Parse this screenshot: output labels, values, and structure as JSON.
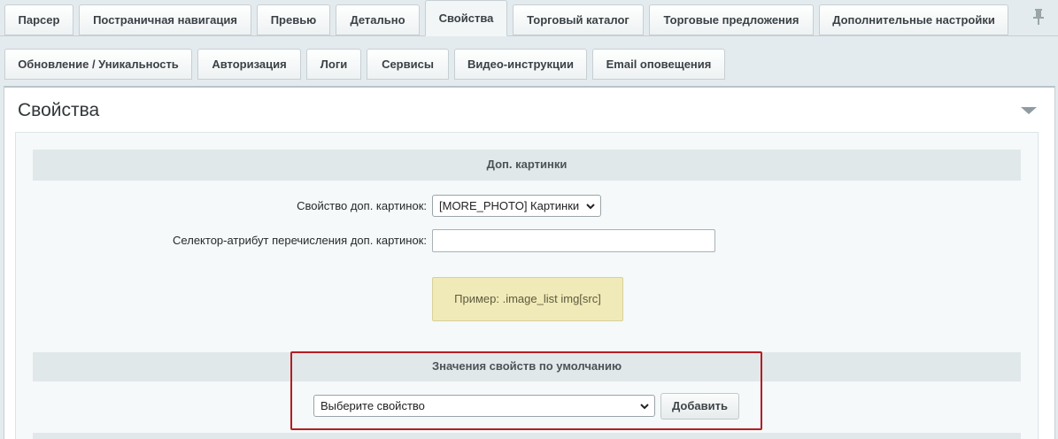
{
  "tabs_row1": [
    {
      "label": "Парсер",
      "active": false
    },
    {
      "label": "Постраничная навигация",
      "active": false
    },
    {
      "label": "Превью",
      "active": false
    },
    {
      "label": "Детально",
      "active": false
    },
    {
      "label": "Свойства",
      "active": true
    },
    {
      "label": "Торговый каталог",
      "active": false
    },
    {
      "label": "Торговые предложения",
      "active": false
    },
    {
      "label": "Дополнительные настройки",
      "active": false
    }
  ],
  "tabs_row2": [
    {
      "label": "Обновление / Уникальность"
    },
    {
      "label": "Авторизация"
    },
    {
      "label": "Логи"
    },
    {
      "label": "Сервисы"
    },
    {
      "label": "Видео-инструкции"
    },
    {
      "label": "Email оповещения"
    }
  ],
  "panel": {
    "title": "Свойства"
  },
  "sections": {
    "extra_images": {
      "title": "Доп. картинки",
      "property_label": "Свойство доп. картинок:",
      "property_value": "[MORE_PHOTO] Картинки",
      "selector_label": "Селектор-атрибут перечисления доп. картинок:",
      "selector_value": "",
      "hint": "Пример: .image_list img[src]"
    },
    "defaults": {
      "title": "Значения свойств по умолчанию",
      "select_value": "Выберите свойство",
      "add_button": "Добавить"
    }
  },
  "colors": {
    "highlight": "#b51d23",
    "hint_bg": "#f0eab8",
    "section_head_bg": "#e0e8ea"
  },
  "icons": [
    "pin-icon",
    "collapse-arrow-icon",
    "chevron-down-icon"
  ]
}
